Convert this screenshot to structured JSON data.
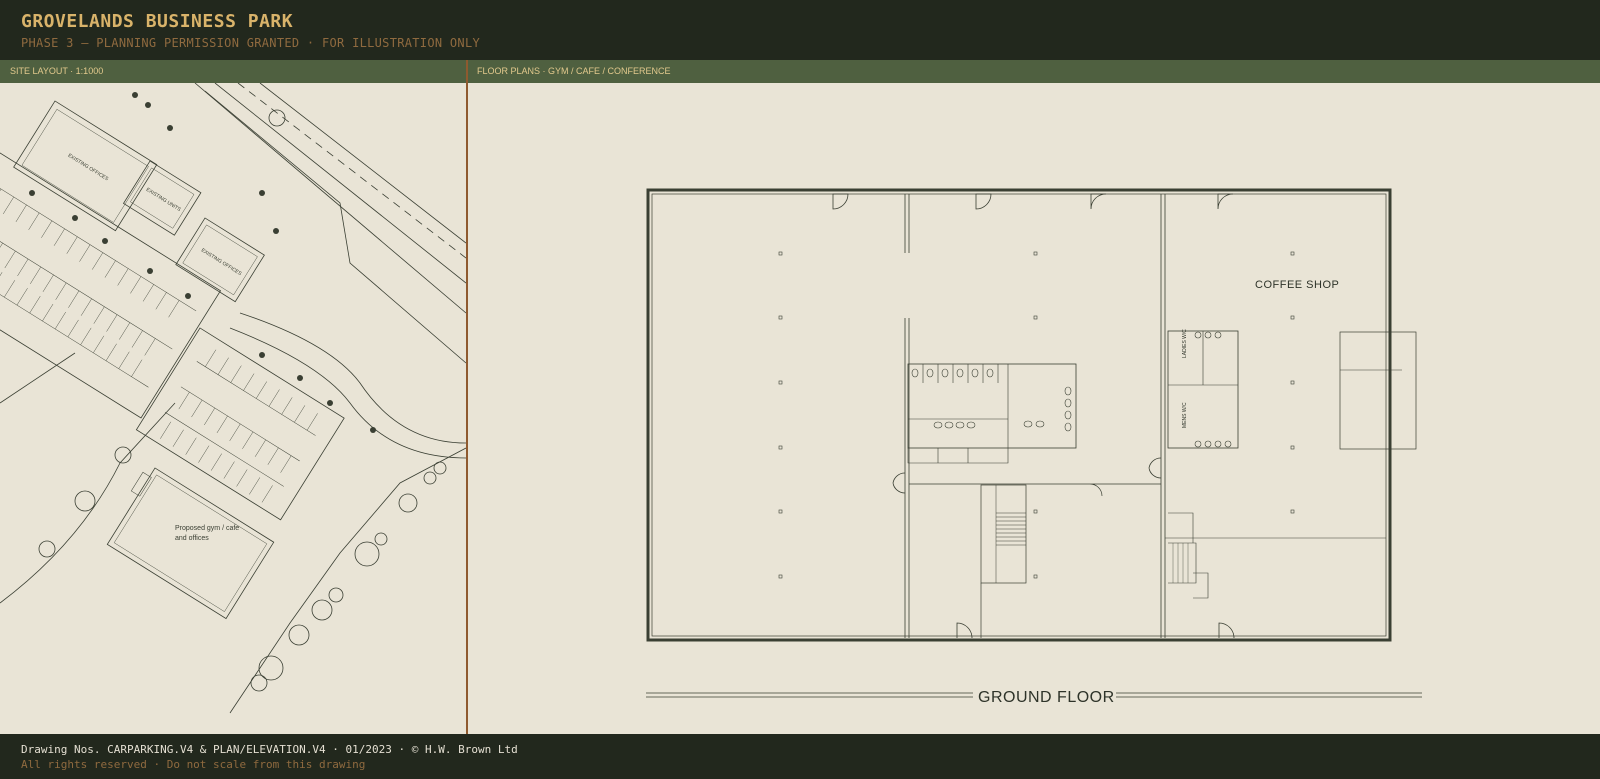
{
  "header": {
    "title": "GROVELANDS BUSINESS PARK",
    "subtitle": "PHASE 3  —  PLANNING PERMISSION GRANTED  ·  FOR ILLUSTRATION ONLY"
  },
  "site_panel": {
    "label": "SITE LAYOUT · 1:1000",
    "buildings": [
      {
        "label": "EXISTING OFFICES"
      },
      {
        "label": "EXISTING UNITS"
      },
      {
        "label": "EXISTING OFFICES"
      }
    ],
    "proposed_line1": "Proposed gym / cafe",
    "proposed_line2": "and offices"
  },
  "plan_panel": {
    "label": "FLOOR PLANS · GYM / CAFE / CONFERENCE",
    "coffee_shop": "COFFEE SHOP",
    "ladies": "LADIES W/C",
    "mens": "MENS W/C",
    "floor_title": "GROUND FLOOR"
  },
  "footer": {
    "line1": "Drawing Nos. CARPARKING.V4 & PLAN/ELEVATION.V4  ·  01/2023  ·  © H.W. Brown Ltd",
    "line2": "All rights reserved  ·  Do not scale from this drawing"
  },
  "colors": {
    "header_bg": "#22281d",
    "bar_bg": "#4f6040",
    "paper": "#e9e4d6",
    "title": "#d9b36a",
    "accent": "#8f6a3f",
    "ink": "#3a3f33"
  }
}
